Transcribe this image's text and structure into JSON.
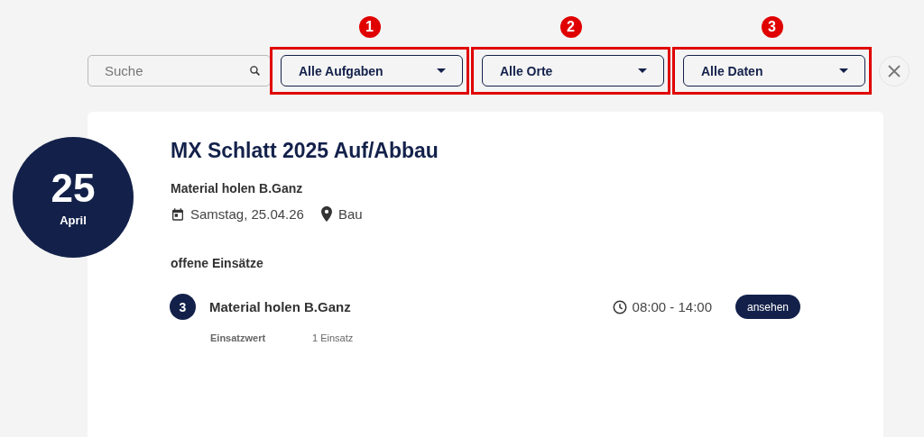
{
  "search": {
    "placeholder": "Suche"
  },
  "filters": [
    {
      "label": "Alle Aufgaben",
      "callout": "1"
    },
    {
      "label": "Alle Orte",
      "callout": "2"
    },
    {
      "label": "Alle Daten",
      "callout": "3"
    }
  ],
  "event": {
    "day": "25",
    "month": "April",
    "title": "MX Schlatt 2025 Auf/Abbau",
    "subtitle": "Material holen B.Ganz",
    "date": "Samstag, 25.04.26",
    "location": "Bau",
    "section": "offene Einsätze",
    "shifts": [
      {
        "count": "3",
        "name": "Material holen B.Ganz",
        "time": "08:00 - 14:00",
        "action": "ansehen",
        "value_label": "Einsatzwert",
        "value": "1 Einsatz"
      }
    ]
  }
}
